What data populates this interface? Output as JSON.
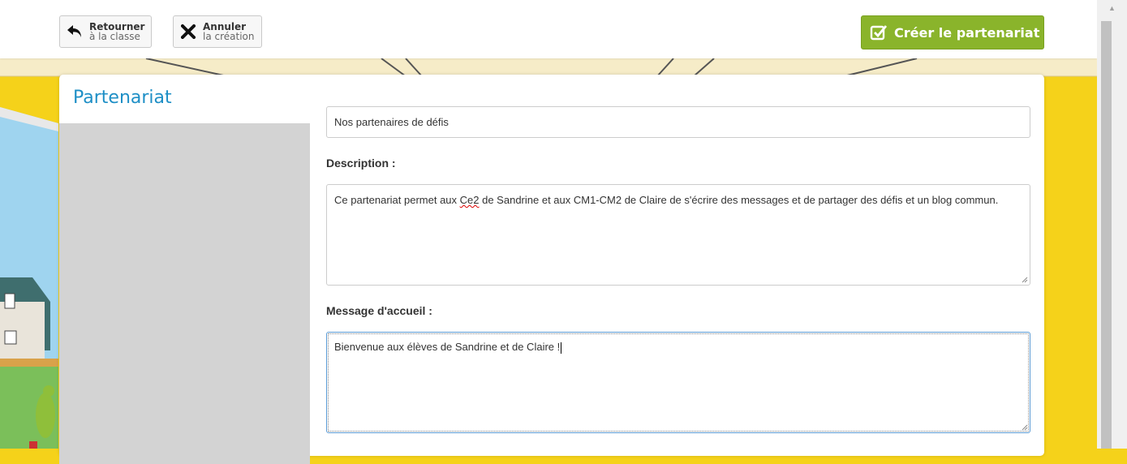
{
  "toolbar": {
    "back_button": {
      "line1": "Retourner",
      "line2": "à la classe",
      "icon": "undo-arrow-icon"
    },
    "cancel_button": {
      "line1": "Annuler",
      "line2": "la création",
      "icon": "close-icon"
    },
    "create_button": {
      "label": "Créer le partenariat",
      "icon": "checkbox-check-icon"
    }
  },
  "panel": {
    "title": "Partenariat",
    "name_value": "Nos partenaires de défis",
    "description_label": "Description :",
    "description_value_parts": [
      "Ce partenariat permet aux ",
      "Ce2",
      " de Sandrine et aux CM1-CM2 de Claire de s'écrire des messages et de partager des défis et un blog commun."
    ],
    "welcome_label": "Message d'accueil :",
    "welcome_value": "Bienvenue aux élèves de Sandrine et de Claire !"
  },
  "colors": {
    "accent_title": "#1e8fc6",
    "create_button": "#8ab42b",
    "background": "#f5d21a"
  }
}
